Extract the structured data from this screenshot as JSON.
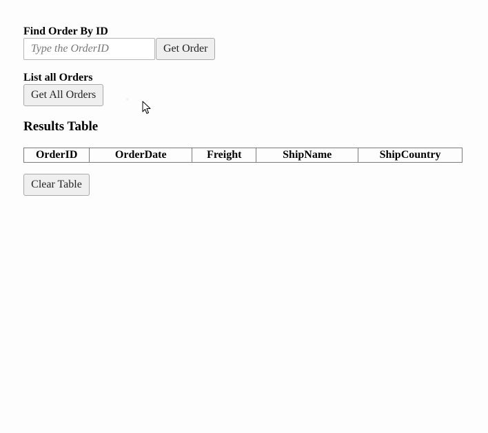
{
  "find_section": {
    "label": "Find Order By ID",
    "input_placeholder": "Type the OrderID",
    "input_value": "",
    "button_label": "Get Order"
  },
  "list_section": {
    "label": "List all Orders",
    "button_label": "Get All Orders"
  },
  "results": {
    "heading": "Results Table",
    "columns": [
      "OrderID",
      "OrderDate",
      "Freight",
      "ShipName",
      "ShipCountry"
    ],
    "rows": [],
    "clear_button_label": "Clear Table"
  }
}
